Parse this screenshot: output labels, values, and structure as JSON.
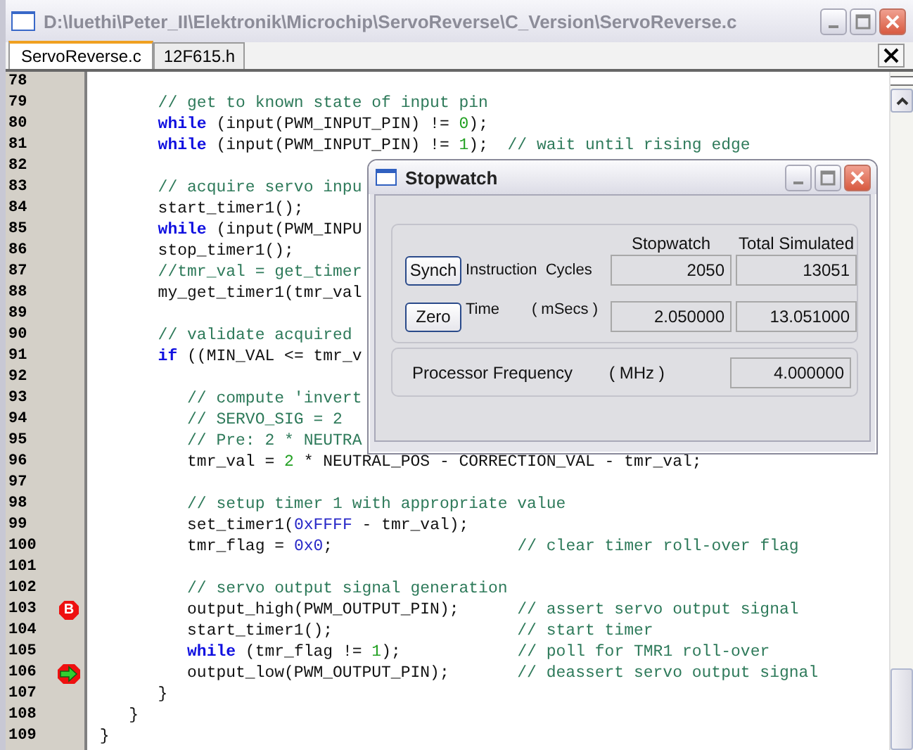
{
  "window": {
    "title": "D:\\luethi\\Peter_II\\Elektronik\\Microchip\\ServoReverse\\C_Version\\ServoReverse.c"
  },
  "tabs": [
    {
      "label": "ServoReverse.c",
      "selected": true
    },
    {
      "label": "12F615.h",
      "selected": false
    }
  ],
  "editor": {
    "lines": [
      {
        "number": "78"
      },
      {
        "number": "79",
        "tokens": [
          {
            "kind": "comment",
            "text": "       // get to known state of input pin"
          }
        ]
      },
      {
        "number": "80",
        "tokens": [
          {
            "kind": "keyword",
            "text": "       while"
          },
          {
            "kind": "code",
            "text": " (input(PWM_INPUT_PIN) != "
          },
          {
            "kind": "number",
            "text": "0"
          },
          {
            "kind": "code",
            "text": ");"
          }
        ]
      },
      {
        "number": "81",
        "tokens": [
          {
            "kind": "keyword",
            "text": "       while"
          },
          {
            "kind": "code",
            "text": " (input(PWM_INPUT_PIN) != "
          },
          {
            "kind": "number",
            "text": "1"
          },
          {
            "kind": "code",
            "text": ");  "
          },
          {
            "kind": "comment",
            "text": "// wait until rising edge"
          }
        ]
      },
      {
        "number": "82"
      },
      {
        "number": "83",
        "tokens": [
          {
            "kind": "comment",
            "text": "       // acquire servo inpu"
          }
        ]
      },
      {
        "number": "84",
        "tokens": [
          {
            "kind": "code",
            "text": "       start_timer1();"
          }
        ]
      },
      {
        "number": "85",
        "tokens": [
          {
            "kind": "keyword",
            "text": "       while"
          },
          {
            "kind": "code",
            "text": " (input(PWM_INPU"
          }
        ]
      },
      {
        "number": "86",
        "tokens": [
          {
            "kind": "code",
            "text": "       stop_timer1();"
          }
        ]
      },
      {
        "number": "87",
        "tokens": [
          {
            "kind": "comment",
            "text": "       //tmr_val = get_timer"
          }
        ]
      },
      {
        "number": "88",
        "tokens": [
          {
            "kind": "code",
            "text": "       my_get_timer1(tmr_val"
          }
        ]
      },
      {
        "number": "89"
      },
      {
        "number": "90",
        "tokens": [
          {
            "kind": "comment",
            "text": "       // validate acquired"
          }
        ]
      },
      {
        "number": "91",
        "tokens": [
          {
            "kind": "keyword",
            "text": "       if"
          },
          {
            "kind": "code",
            "text": " ((MIN_VAL <= tmr_v"
          }
        ]
      },
      {
        "number": "92"
      },
      {
        "number": "93",
        "tokens": [
          {
            "kind": "comment",
            "text": "          // compute 'invert"
          }
        ]
      },
      {
        "number": "94",
        "tokens": [
          {
            "kind": "comment",
            "text": "          // SERVO_SIG = 2"
          }
        ]
      },
      {
        "number": "95",
        "tokens": [
          {
            "kind": "comment",
            "text": "          // Pre: 2 * NEUTRA"
          }
        ]
      },
      {
        "number": "96",
        "tokens": [
          {
            "kind": "code",
            "text": "          tmr_val = "
          },
          {
            "kind": "number",
            "text": "2"
          },
          {
            "kind": "code",
            "text": " * NEUTRAL_POS - CORRECTION_VAL - tmr_val;"
          }
        ]
      },
      {
        "number": "97"
      },
      {
        "number": "98",
        "tokens": [
          {
            "kind": "comment",
            "text": "          // setup timer 1 with appropriate value"
          }
        ]
      },
      {
        "number": "99",
        "tokens": [
          {
            "kind": "code",
            "text": "          set_timer1("
          },
          {
            "kind": "hex",
            "text": "0xFFFF"
          },
          {
            "kind": "code",
            "text": " - tmr_val);"
          }
        ]
      },
      {
        "number": "100",
        "tokens": [
          {
            "kind": "code",
            "text": "          tmr_flag = "
          },
          {
            "kind": "hex",
            "text": "0x0"
          },
          {
            "kind": "code",
            "text": ";                   "
          },
          {
            "kind": "comment",
            "text": "// clear timer roll-over flag"
          }
        ]
      },
      {
        "number": "101"
      },
      {
        "number": "102",
        "tokens": [
          {
            "kind": "comment",
            "text": "          // servo output signal generation"
          }
        ]
      },
      {
        "number": "103",
        "marker": {
          "kind": "breakpoint",
          "label": "B"
        },
        "tokens": [
          {
            "kind": "code",
            "text": "          output_high(PWM_OUTPUT_PIN);      "
          },
          {
            "kind": "comment",
            "text": "// assert servo output signal"
          }
        ]
      },
      {
        "number": "104",
        "tokens": [
          {
            "kind": "code",
            "text": "          start_timer1();                   "
          },
          {
            "kind": "comment",
            "text": "// start timer"
          }
        ]
      },
      {
        "number": "105",
        "tokens": [
          {
            "kind": "keyword",
            "text": "          while"
          },
          {
            "kind": "code",
            "text": " (tmr_flag != "
          },
          {
            "kind": "number",
            "text": "1"
          },
          {
            "kind": "code",
            "text": ");            "
          },
          {
            "kind": "comment",
            "text": "// poll for TMR1 roll-over"
          }
        ]
      },
      {
        "number": "106",
        "marker": {
          "kind": "current"
        },
        "tokens": [
          {
            "kind": "code",
            "text": "          output_low(PWM_OUTPUT_PIN);       "
          },
          {
            "kind": "comment",
            "text": "// deassert servo output signal"
          }
        ]
      },
      {
        "number": "107",
        "tokens": [
          {
            "kind": "code",
            "text": "       }"
          }
        ]
      },
      {
        "number": "108",
        "tokens": [
          {
            "kind": "code",
            "text": "    }"
          }
        ]
      },
      {
        "number": "109",
        "tokens": [
          {
            "kind": "code",
            "text": " }"
          }
        ]
      }
    ]
  },
  "stopwatch": {
    "title": "Stopwatch",
    "columns": [
      "Stopwatch",
      "Total Simulated"
    ],
    "rows": [
      {
        "button": "Synch",
        "label": "Instruction  Cycles",
        "values": [
          "2050",
          "13051"
        ]
      },
      {
        "button": "Zero",
        "label": "Time",
        "unit": "( mSecs )",
        "values": [
          "2.050000",
          "13.051000"
        ]
      }
    ],
    "frequency": {
      "label": "Processor Frequency",
      "unit": "( MHz )",
      "value": "4.000000"
    }
  }
}
